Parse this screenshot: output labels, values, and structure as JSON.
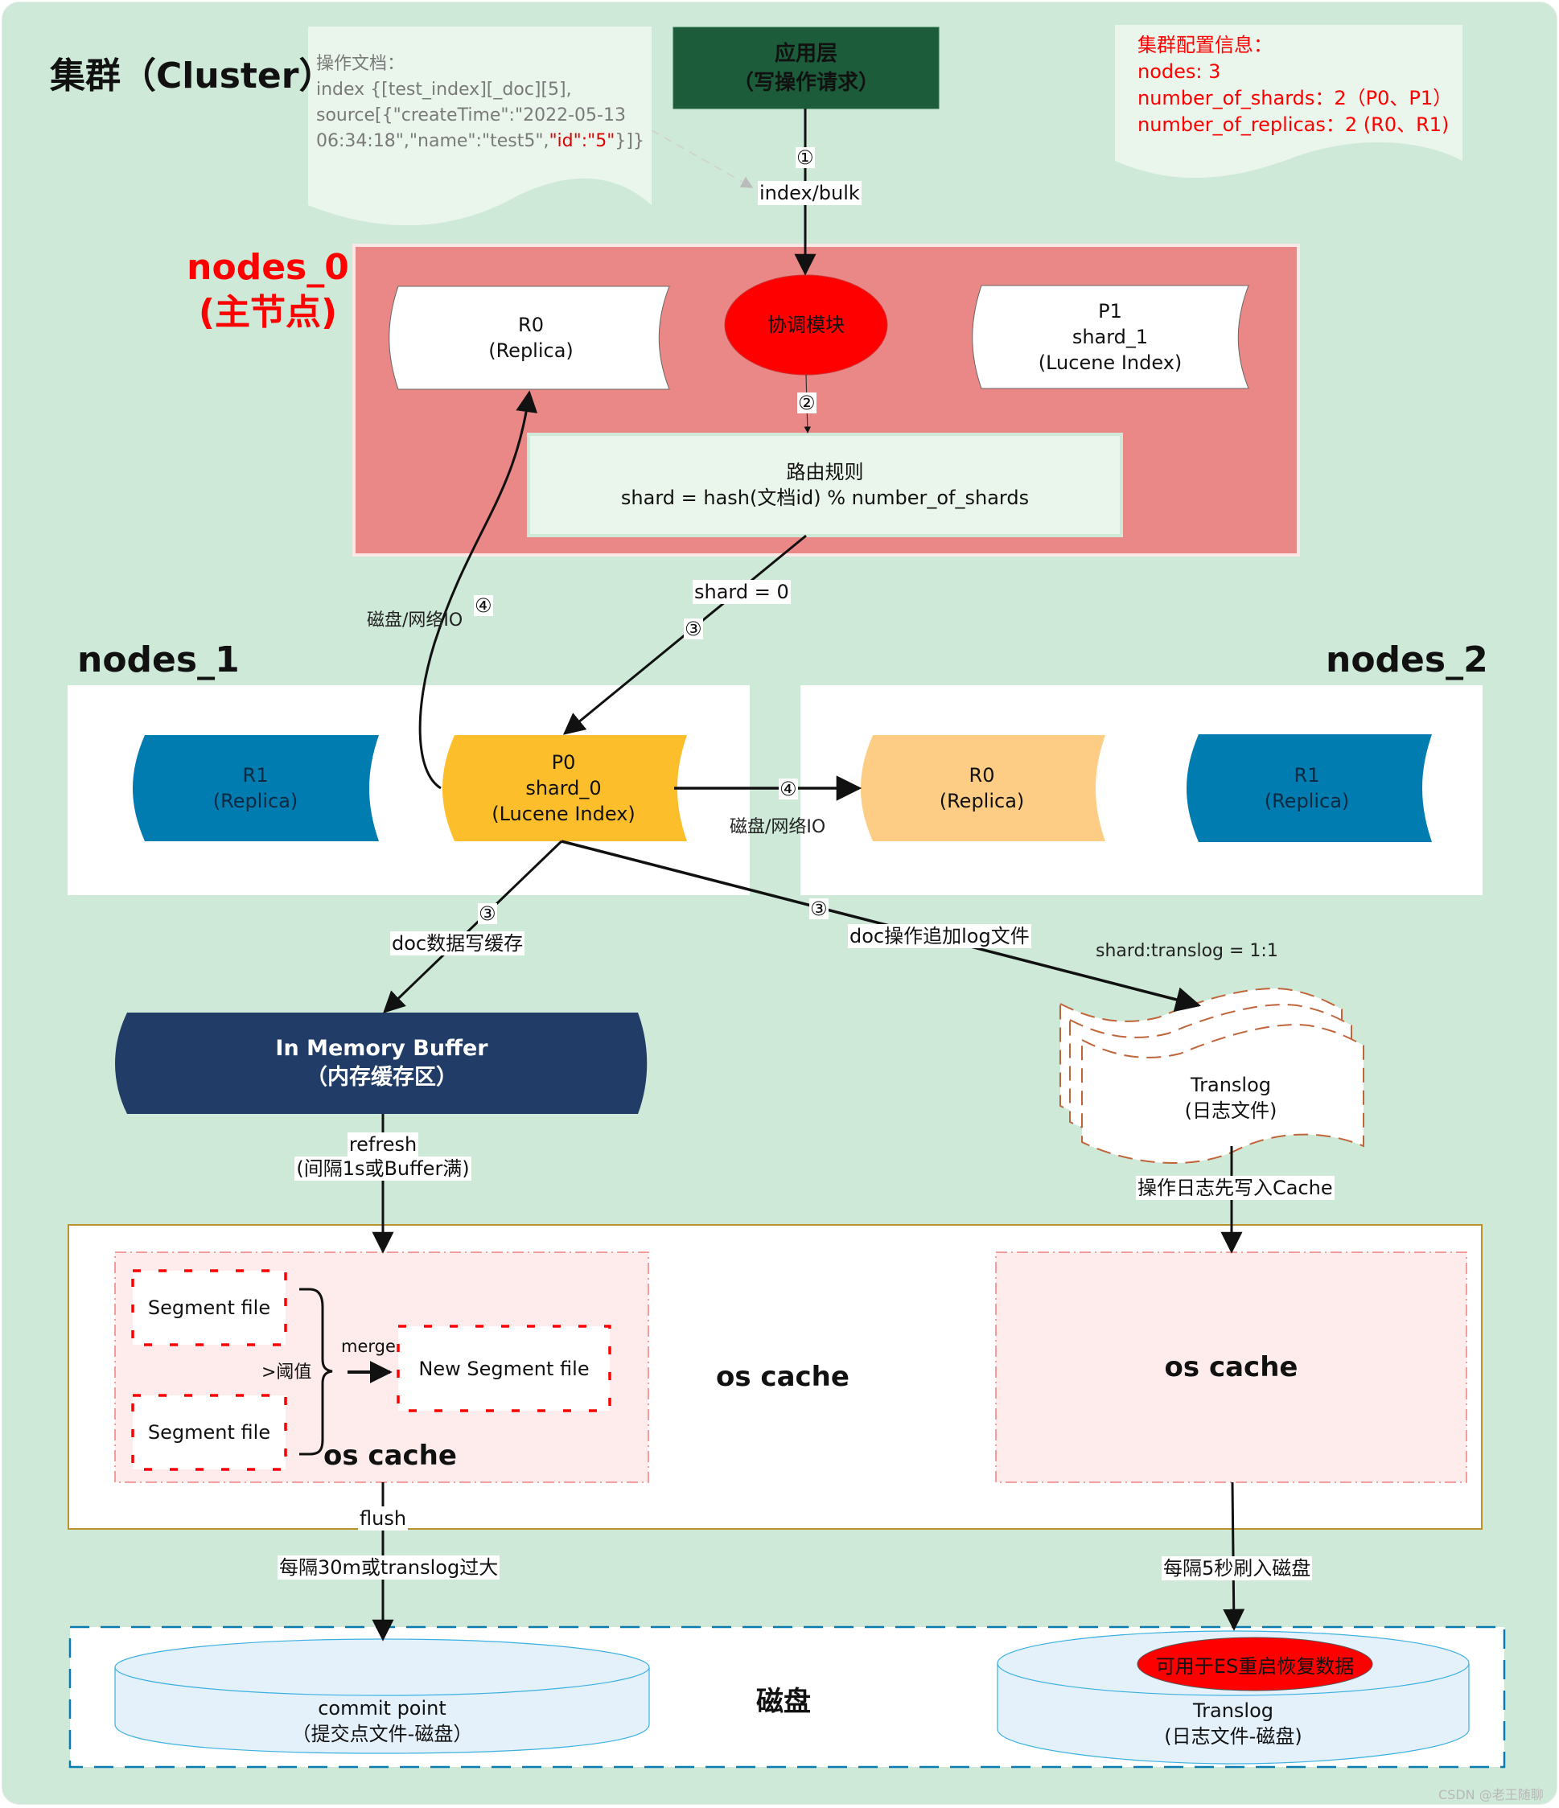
{
  "cluster": {
    "title": "集群（Cluster）",
    "watermark": "CSDN @老王随聊"
  },
  "doc_note": {
    "heading": "操作文档：",
    "line1": "index {[test_index][_doc][5],",
    "line2": "source[{\"createTime\":\"2022-05-13",
    "line3_prefix": "06:34:18\",\"name\":\"test5\",",
    "line3_highlight": "\"id\":\"5\"",
    "line3_suffix": "}]}"
  },
  "app_layer": {
    "line1": "应用层",
    "line2": "（写操作请求）"
  },
  "config_note": {
    "heading": "集群配置信息：",
    "nodes": "nodes: 3",
    "shards": "number_of_shards：2（P0、P1）",
    "replicas": "number_of_replicas：2 (R0、R1)"
  },
  "edges": {
    "step1_num": "①",
    "step1_label": "index/bulk",
    "step2_num": "②",
    "shard_result": "shard = 0",
    "step3_num": "③",
    "step4_num": "④",
    "io_label": "磁盘/网络IO",
    "doc_write_cache": "doc数据写缓存",
    "doc_append_log": "doc操作追加log文件",
    "shard_translog_ratio": "shard:translog = 1:1",
    "refresh_line1": "refresh",
    "refresh_line2": "(间隔1s或Buffer满)",
    "log_to_cache": "操作日志先写入Cache",
    "flush": "flush",
    "flush_condition": "每隔30m或translog过大",
    "translog_flush": "每隔5秒刷入磁盘",
    "merge": "merge",
    "threshold": ">阈值"
  },
  "nodes_0": {
    "title_line1": "nodes_0",
    "title_line2": "(主节点)",
    "r0": {
      "line1": "R0",
      "line2": "(Replica)"
    },
    "coordinator": "协调模块",
    "p1": {
      "line1": "P1",
      "line2": "shard_1",
      "line3": "(Lucene Index)"
    },
    "routing": {
      "line1": "路由规则",
      "line2": "shard = hash(文档id) % number_of_shards"
    }
  },
  "nodes_1": {
    "title": "nodes_1",
    "r1": {
      "line1": "R1",
      "line2": "(Replica)"
    },
    "p0": {
      "line1": "P0",
      "line2": "shard_0",
      "line3": "(Lucene Index)"
    }
  },
  "nodes_2": {
    "title": "nodes_2",
    "r0": {
      "line1": "R0",
      "line2": "(Replica)"
    },
    "r1": {
      "line1": "R1",
      "line2": "(Replica)"
    }
  },
  "memory_buffer": {
    "line1": "In Memory Buffer",
    "line2": "（内存缓存区）"
  },
  "translog_file": {
    "line1": "Translog",
    "line2": "(日志文件)"
  },
  "os_cache_section": {
    "center_label": "os cache",
    "left_label": "os cache",
    "right_label": "os cache",
    "segment_file_1": "Segment file",
    "segment_file_2": "Segment file",
    "new_segment_file": "New Segment file"
  },
  "disk_section": {
    "label": "磁盘",
    "commit_point_line1": "commit point",
    "commit_point_line2": "（提交点文件-磁盘）",
    "translog_disk_badge": "可用于ES重启恢复数据",
    "translog_disk_line1": "Translog",
    "translog_disk_line2": "(日志文件-磁盘)"
  },
  "colors": {
    "cluster_bg": "#cfe9d9",
    "app_layer": "#1c5c3a",
    "nodes_0_bg": "#ea8887",
    "coordinator": "#ff0000",
    "primary_shard": "#fdbe2c",
    "replica_r0": "#fdcd85",
    "replica_r1": "#007cb0",
    "memory_buffer": "#213c66",
    "os_cache_border": "#b8922a",
    "disk_border": "#0a7bb0"
  }
}
